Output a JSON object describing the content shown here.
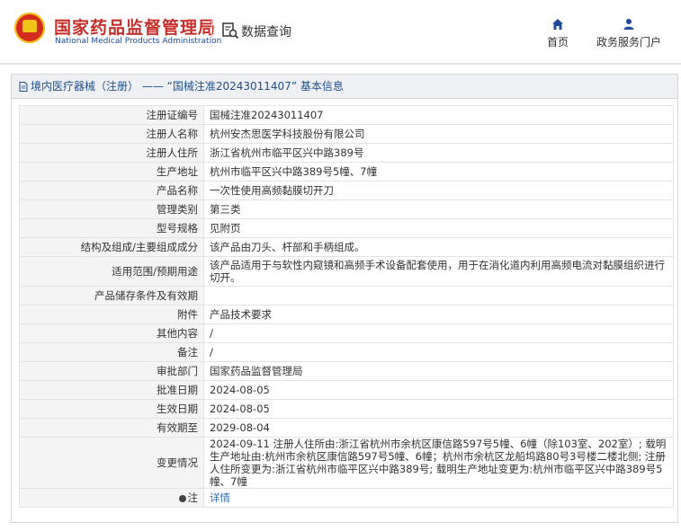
{
  "header": {
    "brand_cn": "国家药品监督管理局",
    "brand_en": "National Medical Products Administration",
    "query_label": "数据查询",
    "nav": [
      {
        "label": "首页",
        "icon": "home-icon"
      },
      {
        "label": "政务服务门户",
        "icon": "user-icon"
      }
    ]
  },
  "panel": {
    "breadcrumb": "境内医疗器械（注册） —— “国械注准20243011407” 基本信息"
  },
  "rows": [
    {
      "key": "注册证编号",
      "value": "国械注准20243011407"
    },
    {
      "key": "注册人名称",
      "value": "杭州安杰思医学科技股份有限公司"
    },
    {
      "key": "注册人住所",
      "value": "浙江省杭州市临平区兴中路389号"
    },
    {
      "key": "生产地址",
      "value": "杭州市临平区兴中路389号5幢、7幢"
    },
    {
      "key": "产品名称",
      "value": "一次性使用高频黏膜切开刀"
    },
    {
      "key": "管理类别",
      "value": "第三类"
    },
    {
      "key": "型号规格",
      "value": "见附页"
    },
    {
      "key": "结构及组成/主要组成成分",
      "value": "该产品由刀头、杆部和手柄组成。"
    },
    {
      "key": "适用范围/预期用途",
      "value": "该产品适用于与软性内窥镜和高频手术设备配套使用，用于在消化道内利用高频电流对黏膜组织进行切开。"
    },
    {
      "key": "产品储存条件及有效期",
      "value": ""
    },
    {
      "key": "附件",
      "value": "产品技术要求"
    },
    {
      "key": "其他内容",
      "value": "/"
    },
    {
      "key": "备注",
      "value": "/"
    },
    {
      "key": "审批部门",
      "value": "国家药品监督管理局"
    },
    {
      "key": "批准日期",
      "value": "2024-08-05"
    },
    {
      "key": "生效日期",
      "value": "2024-08-05"
    },
    {
      "key": "有效期至",
      "value": "2029-08-04"
    },
    {
      "key": "变更情况",
      "value": "2024-09-11 注册人住所由:浙江省杭州市余杭区康信路597号5幢、6幢（除103室、202室）; 载明生产地址由:杭州市余杭区康信路597号5幢、6幢；杭州市余杭区龙船坞路80号3号楼二楼北侧; 注册人住所变更为:浙江省杭州市临平区兴中路389号; 载明生产地址变更为:杭州市临平区兴中路389号5幢、7幢"
    },
    {
      "key": "注",
      "value": "详情"
    }
  ]
}
